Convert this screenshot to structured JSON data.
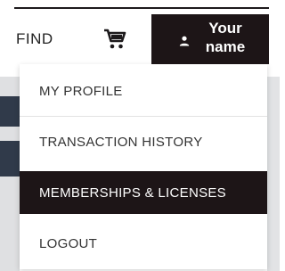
{
  "header": {
    "find_label": "FIND",
    "cart_icon": "shopping-cart-icon",
    "user_icon": "person-icon",
    "user_name_line1": "Your",
    "user_name_line2": "name"
  },
  "dropdown": {
    "items": [
      {
        "label": "MY PROFILE",
        "active": false
      },
      {
        "label": "TRANSACTION HISTORY",
        "active": false
      },
      {
        "label": "MEMBERSHIPS & LICENSES",
        "active": true
      },
      {
        "label": "LOGOUT",
        "active": false
      }
    ]
  },
  "colors": {
    "primary_dark": "#1d1517",
    "text": "#333333",
    "background": "#ffffff"
  }
}
